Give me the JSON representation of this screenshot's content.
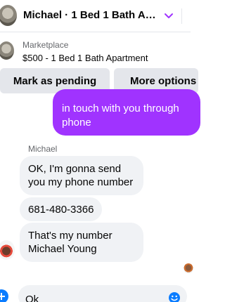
{
  "header": {
    "title": "Michael · 1 Bed 1 Bath Apa...",
    "accent": "#a033ff"
  },
  "listing": {
    "source": "Marketplace",
    "title": "$500 - 1 Bed 1 Bath Apartment"
  },
  "actions": {
    "mark_pending": "Mark as pending",
    "more_options": "More options"
  },
  "messages": {
    "outgoing": {
      "lines": [
        "in touch with you through",
        "phone"
      ]
    },
    "sender": "Michael",
    "incoming": [
      {
        "lines": [
          "OK, I'm gonna send",
          "you my phone number"
        ]
      },
      {
        "lines": [
          "681-480-3366"
        ]
      },
      {
        "lines": [
          "That's my number",
          "Michael Young"
        ]
      }
    ]
  },
  "composer": {
    "value": "Ok"
  },
  "colors": {
    "outgoing_bubble": "#a033ff",
    "incoming_bubble": "#f0f2f5",
    "button_bg": "#e4e6eb",
    "composer_icon": "#0a7cff"
  },
  "icons": [
    "avatar",
    "chevron-down-icon",
    "listing-thumbnail",
    "add-icon",
    "emoji-icon"
  ]
}
